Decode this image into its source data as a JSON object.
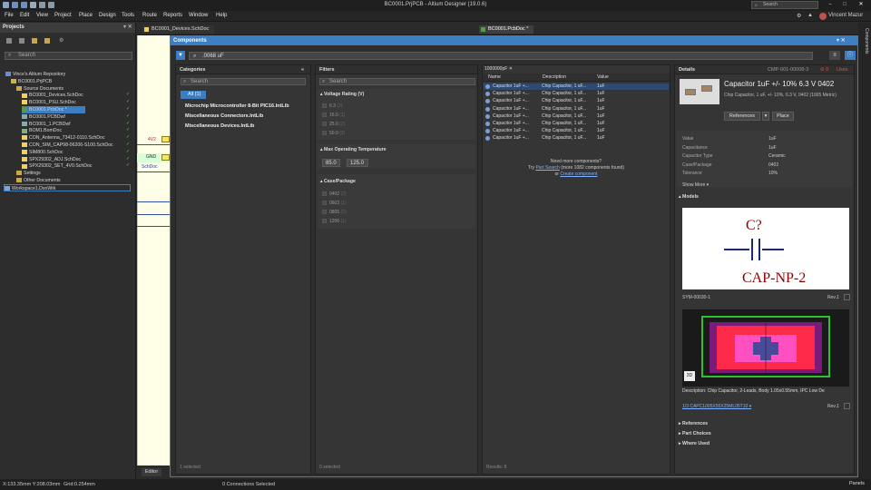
{
  "window": {
    "title": "BC0001.PrjPCB - Altium Designer (19.0.6)",
    "search_placeholder": "Search",
    "user": "Vincent Mazur"
  },
  "menu": [
    "File",
    "Edit",
    "View",
    "Project",
    "Place",
    "Design",
    "Tools",
    "Route",
    "Reports",
    "Window",
    "Help"
  ],
  "projects": {
    "title": "Projects",
    "search_placeholder": "Search",
    "items": [
      {
        "label": "Vince's Altium Repository",
        "indent": 0
      },
      {
        "label": "BC0001.PrjPCB",
        "indent": 1
      },
      {
        "label": "Source Documents",
        "indent": 2
      },
      {
        "label": "BC0001_Devices.SchDoc",
        "indent": 3
      },
      {
        "label": "BC0001_PSU.SchDoc",
        "indent": 3
      },
      {
        "label": "BC0001.PcbDoc *",
        "indent": 3
      },
      {
        "label": "BC0001.PCBDwf",
        "indent": 3
      },
      {
        "label": "BC0001_1.PCBDwf",
        "indent": 3
      },
      {
        "label": "BOM1.BomDoc",
        "indent": 3
      },
      {
        "label": "CON_Antenna_73412-0110.SchDoc",
        "indent": 3
      },
      {
        "label": "CON_SIM_CAP98-06206-S100.SchDoc",
        "indent": 3
      },
      {
        "label": "SIM800.SchDoc",
        "indent": 3
      },
      {
        "label": "SPX29302_ADJ.SchDoc",
        "indent": 3
      },
      {
        "label": "SPX29302_SET_4V0.SchDoc",
        "indent": 3
      },
      {
        "label": "Settings",
        "indent": 2
      },
      {
        "label": "Other Documents",
        "indent": 2
      },
      {
        "label": "Workspace1.DsnWrk",
        "indent": 0
      }
    ]
  },
  "doc_tabs": [
    "BC0001_Devices.SchDoc",
    "BC0001.PcbDoc *"
  ],
  "schematic": {
    "net1": "4V2",
    "net2": "GND",
    "label": "SchDoc",
    "editor_tab": "Editor"
  },
  "components": {
    "title": "Components",
    "search_value": ".0068 uF",
    "categories": {
      "title": "Categories",
      "search_placeholder": "Search",
      "all_label": "All",
      "all_count": "(1)",
      "items": [
        "Microchip Microcontroller 8-Bit PIC16.IntLib",
        "Miscellaneous Connectors.IntLib",
        "Miscellaneous Devices.IntLib"
      ],
      "footer": "1 selected"
    },
    "filters": {
      "title": "Filters",
      "search_placeholder": "Search",
      "voltage_title": "Voltage Rating (V)",
      "voltage": [
        "6.3",
        "16.0",
        "25.0",
        "50.0"
      ],
      "voltage_counts": [
        "(2)",
        "(1)",
        "(2)",
        "(3)"
      ],
      "temp_title": "Max Operating Temperature",
      "temp_min": "85.0",
      "temp_max": "125.0",
      "case_title": "Case/Package",
      "case": [
        "0402",
        "0603",
        "0805",
        "1206"
      ],
      "case_counts": [
        "(2)",
        "(1)",
        "(2)",
        "(1)"
      ],
      "footer": "0 selected"
    },
    "results": {
      "tag": "1000000pF",
      "headers": [
        "Name",
        "Description",
        "Value"
      ],
      "rows": [
        [
          "Capacitor 1uF +...",
          "Chip Capacitor, 1 uF...",
          "1uF"
        ],
        [
          "Capacitor 1uF +...",
          "Chip Capacitor, 1 uF...",
          "1uF"
        ],
        [
          "Capacitor 1uF +...",
          "Chip Capacitor, 1 uF...",
          "1uF"
        ],
        [
          "Capacitor 1uF +...",
          "Chip Capacitor, 1 uF...",
          "1uF"
        ],
        [
          "Capacitor 1uF +...",
          "Chip Capacitor, 1 uF...",
          "1uF"
        ],
        [
          "Capacitor 1uF +...",
          "Chip Capacitor, 1 uF...",
          "1uF"
        ],
        [
          "Capacitor 1uF +...",
          "Chip Capacitor, 1 uF...",
          "1uF"
        ],
        [
          "Capacitor 1uF +...",
          "Chip Capacitor, 1 uF...",
          "1uF"
        ]
      ],
      "need_more": "Need more components?",
      "try_prefix": "Try",
      "part_search": "Part Search",
      "more_found": "(more 1082 components found)",
      "or": "or",
      "create": "Create component",
      "footer": "Results: 8"
    },
    "details": {
      "title": "Details",
      "id": "CMP-001-00008-3",
      "badge": "0",
      "status": "Uses",
      "name": "Capacitor 1uF +/- 10% 6.3 V 0402",
      "desc": "Chip Capacitor, 1 uF, +/- 10%, 6.3 V, 0402 (1005 Metric)",
      "references_btn": "References",
      "place_btn": "Place",
      "params": [
        [
          "Value",
          "1uF"
        ],
        [
          "Capacitance",
          "1uF"
        ],
        [
          "Capacitor Type",
          "Ceramic"
        ],
        [
          "Case/Package",
          "0402"
        ],
        [
          "Tolerance",
          "10%"
        ]
      ],
      "show_more": "Show More",
      "models_title": "Models",
      "sym_designator": "C?",
      "sym_name": "CAP-NP-2",
      "sym_id": "SYM-00030-1",
      "sym_rev": "Rev.1",
      "fp_desc": "Description: Chip Capacitor, 2-Leads, Body 1.05x0.55mm, IPC Low De",
      "fp_id": "1/3 CAPC1005X55X25ML05T10",
      "fp_rev": "Rev.1",
      "badge3d": "3D",
      "sections": [
        "References",
        "Part Choices",
        "Where Used"
      ]
    }
  },
  "right_panel": "Components",
  "status": {
    "coords": "X:133.35mm Y:208.03mm",
    "grid": "Grid:0.254mm",
    "connections": "0 Connections Selected",
    "panels": "Panels"
  }
}
